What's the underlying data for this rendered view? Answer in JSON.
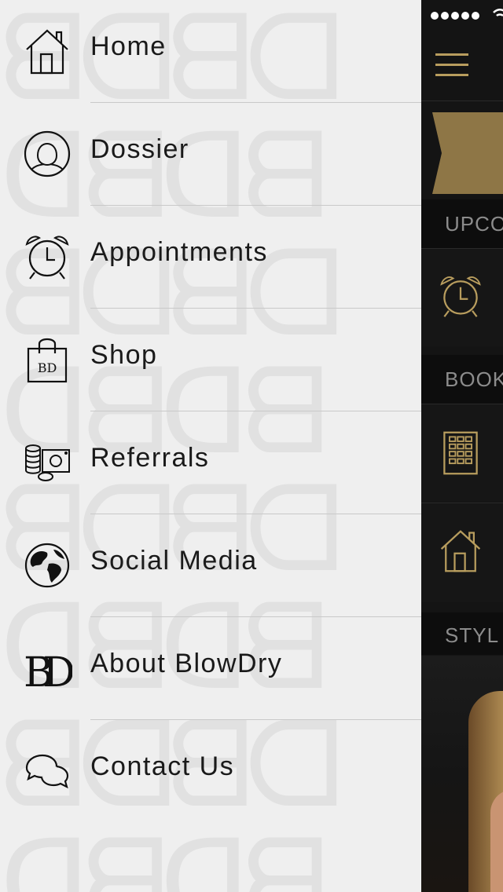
{
  "menu": {
    "items": [
      {
        "label": "Home",
        "icon": "home-icon"
      },
      {
        "label": "Dossier",
        "icon": "user-profile-icon"
      },
      {
        "label": "Appointments",
        "icon": "alarm-clock-icon"
      },
      {
        "label": "Shop",
        "icon": "shopping-bag-icon"
      },
      {
        "label": "Referrals",
        "icon": "coins-cash-icon"
      },
      {
        "label": "Social Media",
        "icon": "globe-icon"
      },
      {
        "label": "About BlowDry",
        "icon": "bd-logo-icon"
      },
      {
        "label": "Contact Us",
        "icon": "chat-bubbles-icon"
      }
    ]
  },
  "background_app": {
    "sections": [
      {
        "title": "UPCO"
      },
      {
        "title": "BOOK"
      },
      {
        "title": "STYL"
      }
    ],
    "accent_color": "#b89d5e"
  }
}
